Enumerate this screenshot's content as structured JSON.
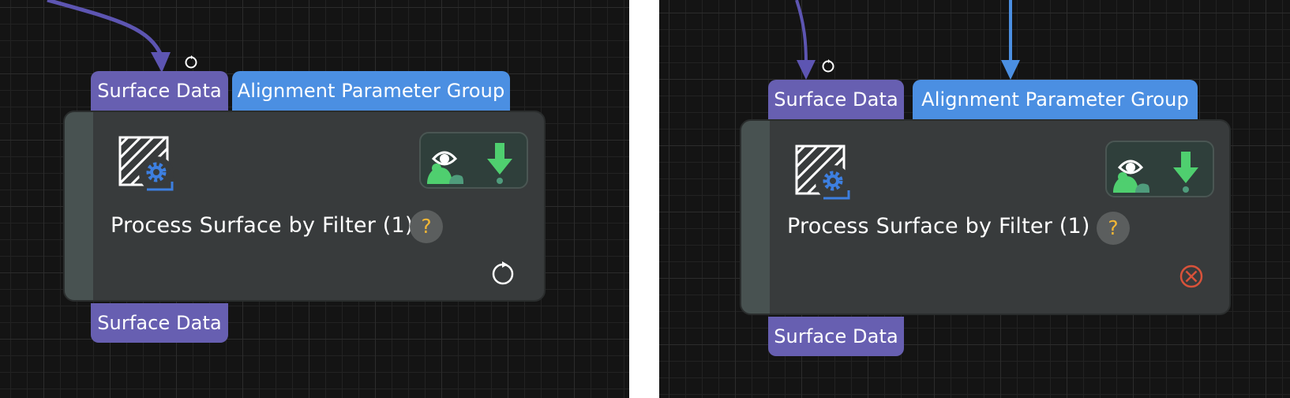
{
  "panels": [
    {
      "id": "left",
      "ports": {
        "input_surface": "Surface Data",
        "input_alignment": "Alignment Parameter Group",
        "output_surface": "Surface Data"
      },
      "node": {
        "title": "Process Surface by Filter (1)",
        "help": "?",
        "status": "running-icon"
      }
    },
    {
      "id": "right",
      "ports": {
        "input_surface": "Surface Data",
        "input_alignment": "Alignment Parameter Group",
        "output_surface": "Surface Data"
      },
      "node": {
        "title": "Process Surface by Filter (1)",
        "help": "?",
        "status": "error-icon"
      }
    }
  ],
  "colors": {
    "canvas_bg": "#141414",
    "surface_port": "#675fb1",
    "alignment_port": "#4b8fe2",
    "node_bg": "#383b3c",
    "node_strip": "#485251",
    "preview_green": "#4fcf6f",
    "help_question": "#f3b735",
    "error_red": "#d8523a",
    "wire_surface": "#5d55b2",
    "wire_alignment": "#4b8fe2"
  }
}
